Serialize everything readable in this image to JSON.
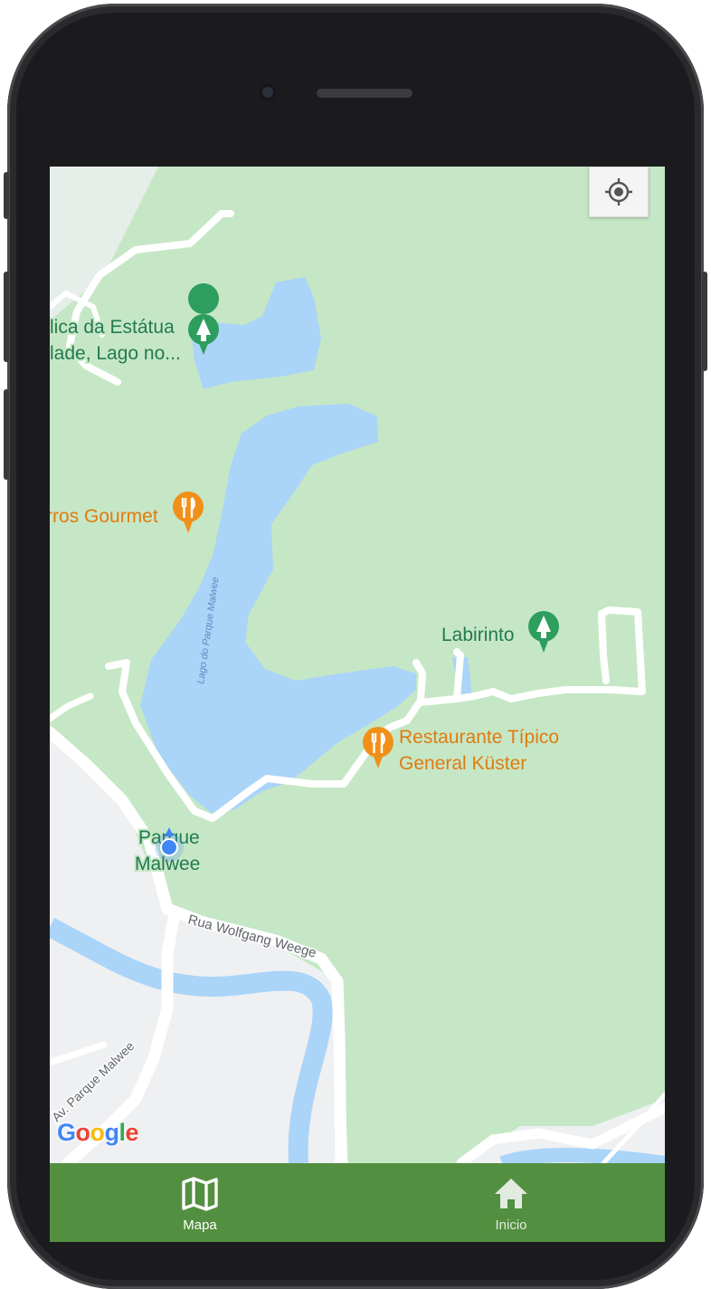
{
  "map": {
    "places": [
      {
        "name": "lica da Estátua",
        "name2": "lade, Lago no...",
        "kind": "park"
      },
      {
        "name": "rros Gourmet",
        "kind": "restaurant"
      },
      {
        "name": "Labirinto",
        "kind": "park"
      },
      {
        "name": "Restaurante Típico",
        "name2": "General Küster",
        "kind": "restaurant"
      },
      {
        "name": "Parque",
        "name2": "Malwee",
        "kind": "park"
      }
    ],
    "lake_label": "Lago do Parque Malwee",
    "streets": [
      "Rua Wolfgang Weege",
      "Av. Parque Malwee"
    ],
    "attribution": "Google",
    "colors": {
      "park": "#c6e7c5",
      "water": "#aad4f8",
      "urban": "#eef0f2",
      "road": "#ffffff",
      "park_text": "#237a51",
      "food_text": "#e07b11",
      "nav": "#538f40"
    }
  },
  "controls": {
    "my_location_icon": "crosshair-icon"
  },
  "nav": {
    "items": [
      {
        "label": "Mapa",
        "icon": "map-icon",
        "active": true
      },
      {
        "label": "Inicio",
        "icon": "home-icon",
        "active": false
      }
    ]
  }
}
